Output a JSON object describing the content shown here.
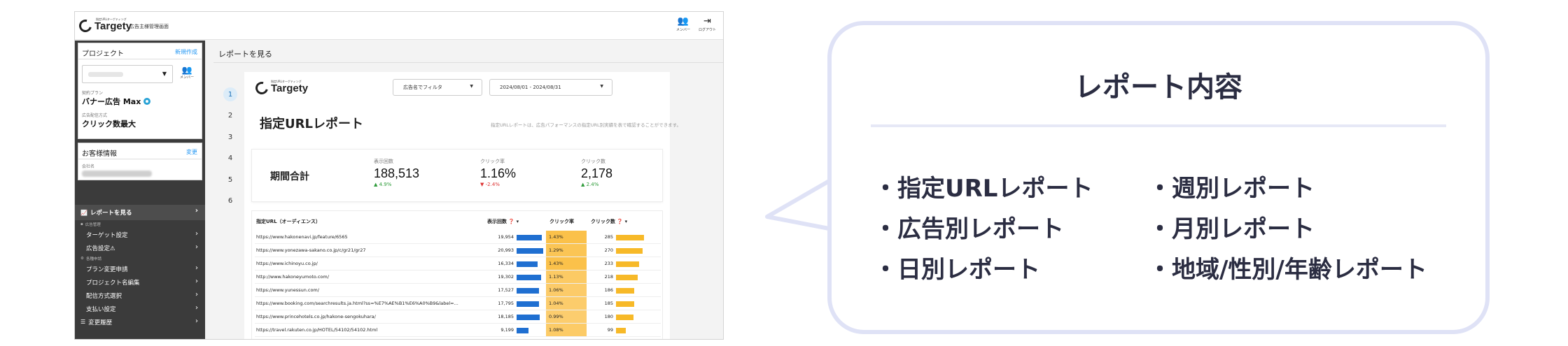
{
  "app": {
    "brand_small": "指定URLターゲティング",
    "brand": "Targety",
    "subtitle": "広告主様管理画面",
    "actions": [
      {
        "label": "メンバー",
        "icon": "users-icon"
      },
      {
        "label": "ログアウト",
        "icon": "logout-icon"
      }
    ]
  },
  "sidebar": {
    "project": {
      "heading": "プロジェクト",
      "new_link": "新規作成",
      "member_label": "メンバー",
      "plan_label": "契約プラン",
      "plan_value": "バナー広告 Max",
      "delivery_label": "広告配信方式",
      "delivery_value": "クリック数最大"
    },
    "customer": {
      "heading": "お客様情報",
      "change_link": "変更",
      "company_label": "会社名"
    },
    "nav": {
      "report": "レポートを見る",
      "ad_group": "広告管理",
      "target": "ターゲット設定",
      "ad_setting": "広告設定⚠",
      "apply_group": "各種申請",
      "plan_change": "プラン変更申請",
      "project_rename": "プロジェクト名編集",
      "delivery_select": "配信方式選択",
      "payment": "支払い設定",
      "history": "変更履歴"
    }
  },
  "main": {
    "title": "レポートを見る",
    "steps": [
      "1",
      "2",
      "3",
      "4",
      "5",
      "6"
    ],
    "filter_ad": "広告名でフィルタ",
    "filter_date": "2024/08/01 - 2024/08/31",
    "report_title": "指定URLレポート",
    "report_desc": "指定URLレポートは、広告パフォーマンスの指定URL別実績を表で確認することができます。",
    "summary": {
      "label": "期間合計",
      "metrics": [
        {
          "label": "表示回数",
          "value": "188,513",
          "delta": "▲ 4.9%",
          "dir": "up"
        },
        {
          "label": "クリック率",
          "value": "1.16%",
          "delta": "▼ -2.4%",
          "dir": "down"
        },
        {
          "label": "クリック数",
          "value": "2,178",
          "delta": "▲ 2.4%",
          "dir": "up"
        }
      ]
    },
    "table": {
      "headers": {
        "url": "指定URL（オーディエンス）",
        "impressions": "表示回数 ❓ ▾",
        "ctr": "クリック率",
        "clicks": "クリック数 ❓ ▾"
      },
      "max_impressions": 20993,
      "max_ctr": 1.43,
      "max_clicks": 285,
      "rows": [
        {
          "url": "https://www.hakonenavi.jp/feature/6565",
          "impressions": "19,954",
          "imp": 19954,
          "ctr": "1.43%",
          "ctr_v": 1.43,
          "clicks": "285",
          "clk": 285
        },
        {
          "url": "https://www.yonezawa-sakano.co.jp/c/gr21/gr27",
          "impressions": "20,993",
          "imp": 20993,
          "ctr": "1.29%",
          "ctr_v": 1.29,
          "clicks": "270",
          "clk": 270
        },
        {
          "url": "https://www.ichinoyu.co.jp/",
          "impressions": "16,334",
          "imp": 16334,
          "ctr": "1.43%",
          "ctr_v": 1.43,
          "clicks": "233",
          "clk": 233
        },
        {
          "url": "http://www.hakoneyumoto.com/",
          "impressions": "19,302",
          "imp": 19302,
          "ctr": "1.13%",
          "ctr_v": 1.13,
          "clicks": "218",
          "clk": 218
        },
        {
          "url": "https://www.yunessun.com/",
          "impressions": "17,527",
          "imp": 17527,
          "ctr": "1.06%",
          "ctr_v": 1.06,
          "clicks": "186",
          "clk": 186
        },
        {
          "url": "https://www.booking.com/searchresults.ja.html?ss=%E7%AE%B1%E6%A0%B9&label=...",
          "impressions": "17,795",
          "imp": 17795,
          "ctr": "1.04%",
          "ctr_v": 1.04,
          "clicks": "185",
          "clk": 185
        },
        {
          "url": "https://www.princehotels.co.jp/hakone-sengokuhara/",
          "impressions": "18,185",
          "imp": 18185,
          "ctr": "0.99%",
          "ctr_v": 0.99,
          "clicks": "180",
          "clk": 180
        },
        {
          "url": "https://travel.rakuten.co.jp/HOTEL/54102/54102.html",
          "impressions": "9,199",
          "imp": 9199,
          "ctr": "1.08%",
          "ctr_v": 1.08,
          "clicks": "99",
          "clk": 99
        }
      ]
    }
  },
  "callout": {
    "title": "レポート内容",
    "left": [
      "・指定URLレポート",
      "・広告別レポート",
      "・日別レポート"
    ],
    "right": [
      "・週別レポート",
      "・月別レポート",
      "・地域/性別/年齢レポート"
    ]
  },
  "colors": {
    "impressions_bar": "#1f6fd1",
    "clicks_bar": "#f7b928",
    "ctr_cell": "#fbc14a",
    "callout_border": "#dfe2f6",
    "link": "#2196f3"
  }
}
